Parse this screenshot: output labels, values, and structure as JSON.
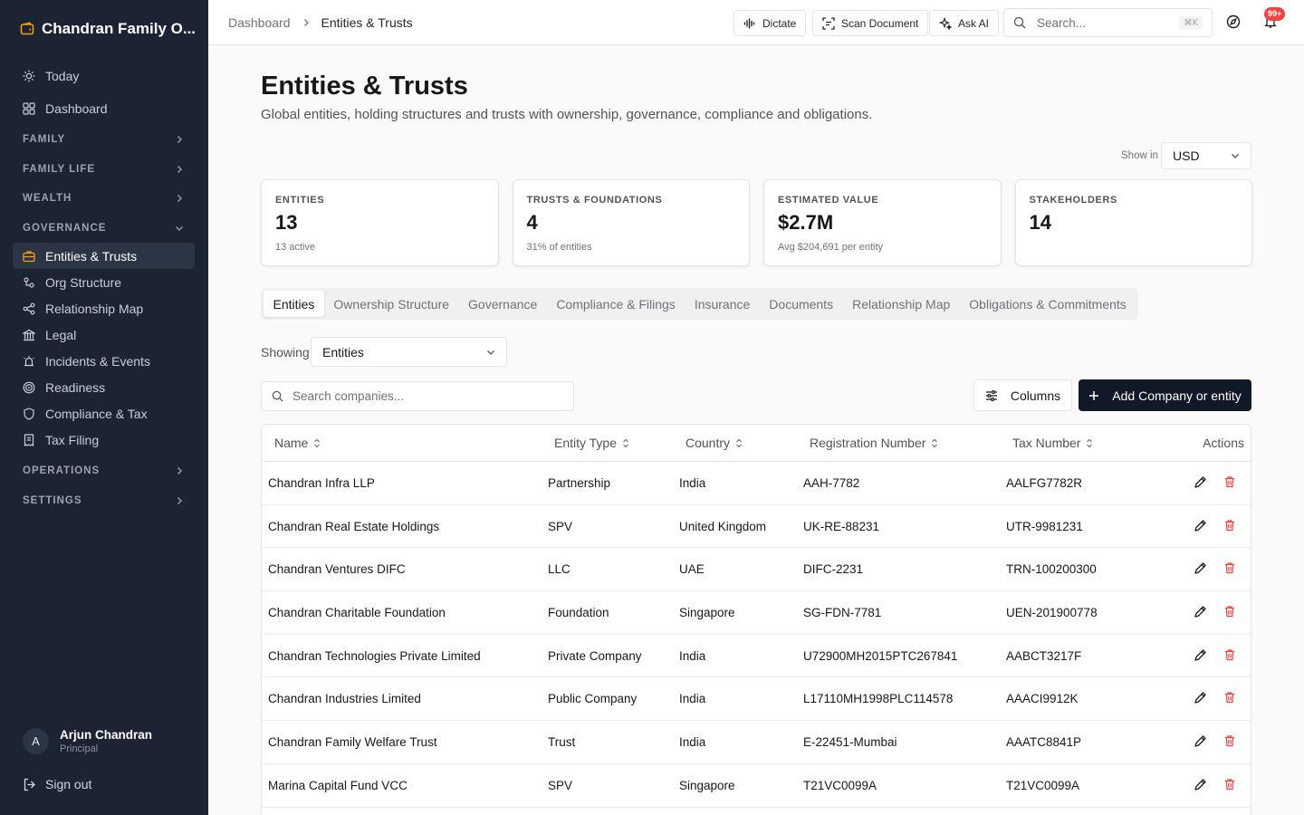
{
  "app": {
    "name": "Chandran Family O..."
  },
  "sidebar": {
    "top_items": [
      {
        "label": "Today",
        "icon": "sun-icon"
      },
      {
        "label": "Dashboard",
        "icon": "grid-icon"
      }
    ],
    "sections_before": [
      {
        "label": "FAMILY"
      },
      {
        "label": "FAMILY LIFE"
      },
      {
        "label": "WEALTH"
      }
    ],
    "governance": {
      "label": "GOVERNANCE",
      "items": [
        {
          "label": "Entities & Trusts",
          "icon": "briefcase-icon",
          "active": true
        },
        {
          "label": "Org Structure",
          "icon": "org-icon"
        },
        {
          "label": "Relationship Map",
          "icon": "share-icon"
        },
        {
          "label": "Legal",
          "icon": "landmark-icon"
        },
        {
          "label": "Incidents & Events",
          "icon": "siren-icon"
        },
        {
          "label": "Readiness",
          "icon": "target-icon"
        },
        {
          "label": "Compliance & Tax",
          "icon": "shield-icon"
        },
        {
          "label": "Tax Filing",
          "icon": "receipt-icon"
        }
      ]
    },
    "sections_after": [
      {
        "label": "OPERATIONS"
      },
      {
        "label": "SETTINGS"
      }
    ],
    "user": {
      "initial": "A",
      "name": "Arjun Chandran",
      "role": "Principal"
    },
    "sign_out": "Sign out"
  },
  "topbar": {
    "breadcrumb": {
      "parent": "Dashboard",
      "current": "Entities & Trusts"
    },
    "dictate": "Dictate",
    "scan": "Scan Document",
    "ask_ai": "Ask AI",
    "search_placeholder": "Search...",
    "shortcut": "⌘K",
    "notifications_badge": "99+"
  },
  "page": {
    "title": "Entities & Trusts",
    "subtitle": "Global entities, holding structures and trusts with ownership, governance, compliance and obligations.",
    "show_in_label": "Show in",
    "currency": "USD"
  },
  "cards": [
    {
      "label": "ENTITIES",
      "value": "13",
      "sub": "13 active"
    },
    {
      "label": "TRUSTS & FOUNDATIONS",
      "value": "4",
      "sub": "31% of entities"
    },
    {
      "label": "ESTIMATED VALUE",
      "value": "$2.7M",
      "sub": "Avg $204,691 per entity"
    },
    {
      "label": "STAKEHOLDERS",
      "value": "14",
      "sub": ""
    }
  ],
  "tabs": [
    {
      "label": "Entities",
      "active": true
    },
    {
      "label": "Ownership Structure"
    },
    {
      "label": "Governance"
    },
    {
      "label": "Compliance & Filings"
    },
    {
      "label": "Insurance"
    },
    {
      "label": "Documents"
    },
    {
      "label": "Relationship Map"
    },
    {
      "label": "Obligations & Commitments"
    }
  ],
  "filters": {
    "showing_label": "Showing",
    "showing_value": "Entities",
    "search_placeholder": "Search companies...",
    "columns_label": "Columns",
    "add_label": "Add Company or entity"
  },
  "table": {
    "headers": [
      "Name",
      "Entity Type",
      "Country",
      "Registration Number",
      "Tax Number",
      "Actions"
    ],
    "rows": [
      [
        "Chandran Infra LLP",
        "Partnership",
        "India",
        "AAH-7782",
        "AALFG7782R"
      ],
      [
        "Chandran Real Estate Holdings",
        "SPV",
        "United Kingdom",
        "UK-RE-88231",
        "UTR-9981231"
      ],
      [
        "Chandran Ventures DIFC",
        "LLC",
        "UAE",
        "DIFC-2231",
        "TRN-100200300"
      ],
      [
        "Chandran Charitable Foundation",
        "Foundation",
        "Singapore",
        "SG-FDN-7781",
        "UEN-201900778"
      ],
      [
        "Chandran Technologies Private Limited",
        "Private Company",
        "India",
        "U72900MH2015PTC267841",
        "AABCT3217F"
      ],
      [
        "Chandran Industries Limited",
        "Public Company",
        "India",
        "L17110MH1998PLC114578",
        "AAACI9912K"
      ],
      [
        "Chandran Family Welfare Trust",
        "Trust",
        "India",
        "E-22451-Mumbai",
        "AAATC8841P"
      ],
      [
        "Marina Capital Fund VCC",
        "SPV",
        "Singapore",
        "T21VC0099A",
        "T21VC0099A"
      ]
    ]
  },
  "colors": {
    "sidebar_bg": "#1c2433",
    "brand_accent": "#f59e0b",
    "delete_red": "#ef4444",
    "primary_button": "#111827"
  }
}
